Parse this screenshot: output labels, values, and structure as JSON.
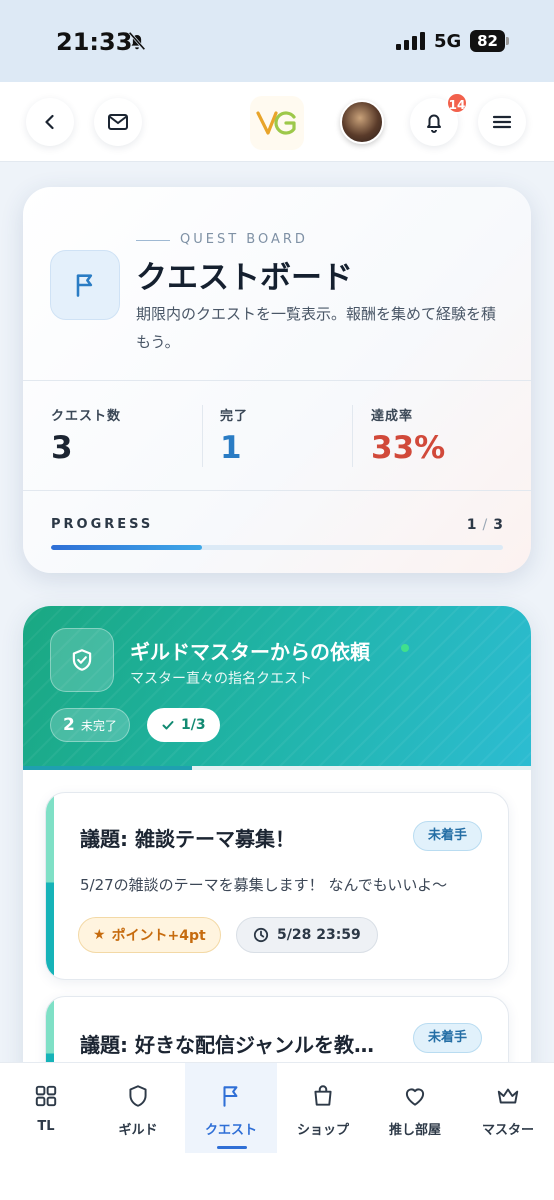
{
  "status_bar": {
    "time": "21:33",
    "network": "5G",
    "battery": "82"
  },
  "header": {
    "notification_count": "14"
  },
  "quest_board": {
    "eyebrow": "QUEST BOARD",
    "title": "クエストボード",
    "description": "期限内のクエストを一覧表示。報酬を集めて経験を積もう。",
    "stats": [
      {
        "label": "クエスト数",
        "value": "3",
        "color": "#1c2532"
      },
      {
        "label": "完了",
        "value": "1",
        "color": "#2a7cc4"
      },
      {
        "label": "達成率",
        "value": "33%",
        "color": "#d1493a"
      }
    ],
    "progress": {
      "label": "PROGRESS",
      "done": "1",
      "total": "3",
      "fraction": 0.333
    }
  },
  "guild": {
    "title": "ギルドマスターからの依頼",
    "subtitle": "マスター直々の指名クエスト",
    "open_count": "2",
    "open_label": "未完了",
    "done_label": "1/3",
    "progress_fraction": 0.333,
    "quests": [
      {
        "title": "議題: 雑談テーマ募集！",
        "status": "未着手",
        "description": "5/27の雑談のテーマを募集します！ なんでもいいよ〜",
        "points": "ポイント+4pt",
        "deadline": "5/28 23:59"
      },
      {
        "title": "議題: 好きな配信ジャンルを教…",
        "status": "未着手"
      }
    ]
  },
  "nav": {
    "items": [
      {
        "label": "TL",
        "icon": "grid-icon"
      },
      {
        "label": "ギルド",
        "icon": "shield-icon"
      },
      {
        "label": "クエスト",
        "icon": "flag-icon",
        "active": true
      },
      {
        "label": "ショップ",
        "icon": "shopping-bag-icon"
      },
      {
        "label": "推し部屋",
        "icon": "heart-icon"
      },
      {
        "label": "マスター",
        "icon": "crown-icon"
      }
    ]
  }
}
